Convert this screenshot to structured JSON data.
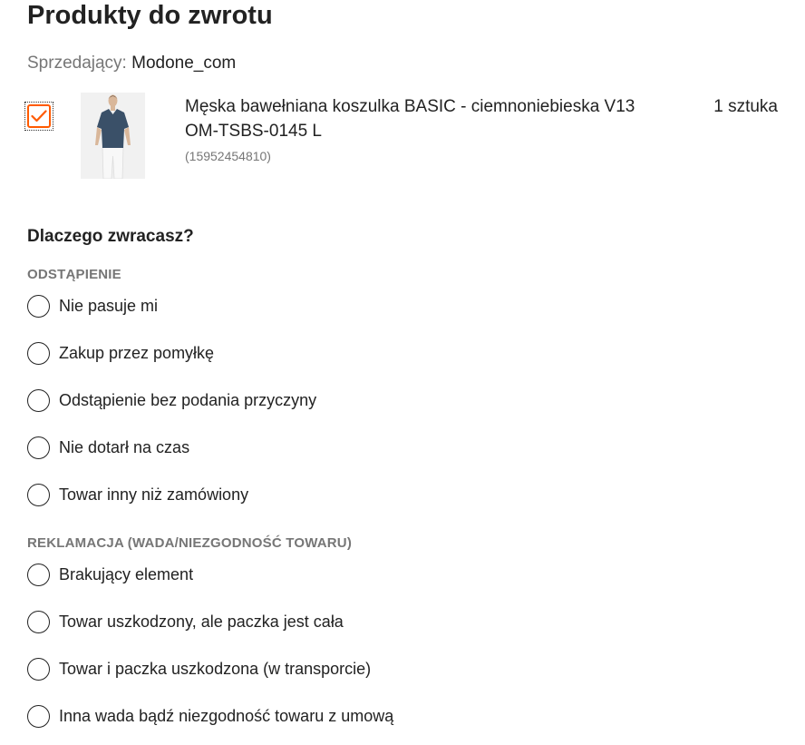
{
  "header": {
    "title": "Produkty do zwrotu"
  },
  "seller": {
    "label": "Sprzedający: ",
    "name": "Modone_com"
  },
  "product": {
    "checked": true,
    "name": "Męska bawełniana koszulka BASIC - ciemnoniebieska V13 OM-TSBS-0145 L",
    "id": "(15952454810)",
    "quantity": "1 sztuka",
    "image_icon": "tshirt-model-photo"
  },
  "reasons": {
    "question": "Dlaczego zwracasz?",
    "groups": [
      {
        "label": "ODSTĄPIENIE",
        "options": [
          "Nie pasuje mi",
          "Zakup przez pomyłkę",
          "Odstąpienie bez podania przyczyny",
          "Nie dotarł na czas",
          "Towar inny niż zamówiony"
        ]
      },
      {
        "label": "REKLAMACJA (WADA/NIEZGODNOŚĆ TOWARU)",
        "options": [
          "Brakujący element",
          "Towar uszkodzony, ale paczka jest cała",
          "Towar i paczka uszkodzona (w transporcie)",
          "Inna wada bądź niezgodność towaru z umową"
        ]
      }
    ]
  },
  "colors": {
    "accent": "#ff5a00",
    "muted_text": "#767676",
    "text": "#222222"
  }
}
